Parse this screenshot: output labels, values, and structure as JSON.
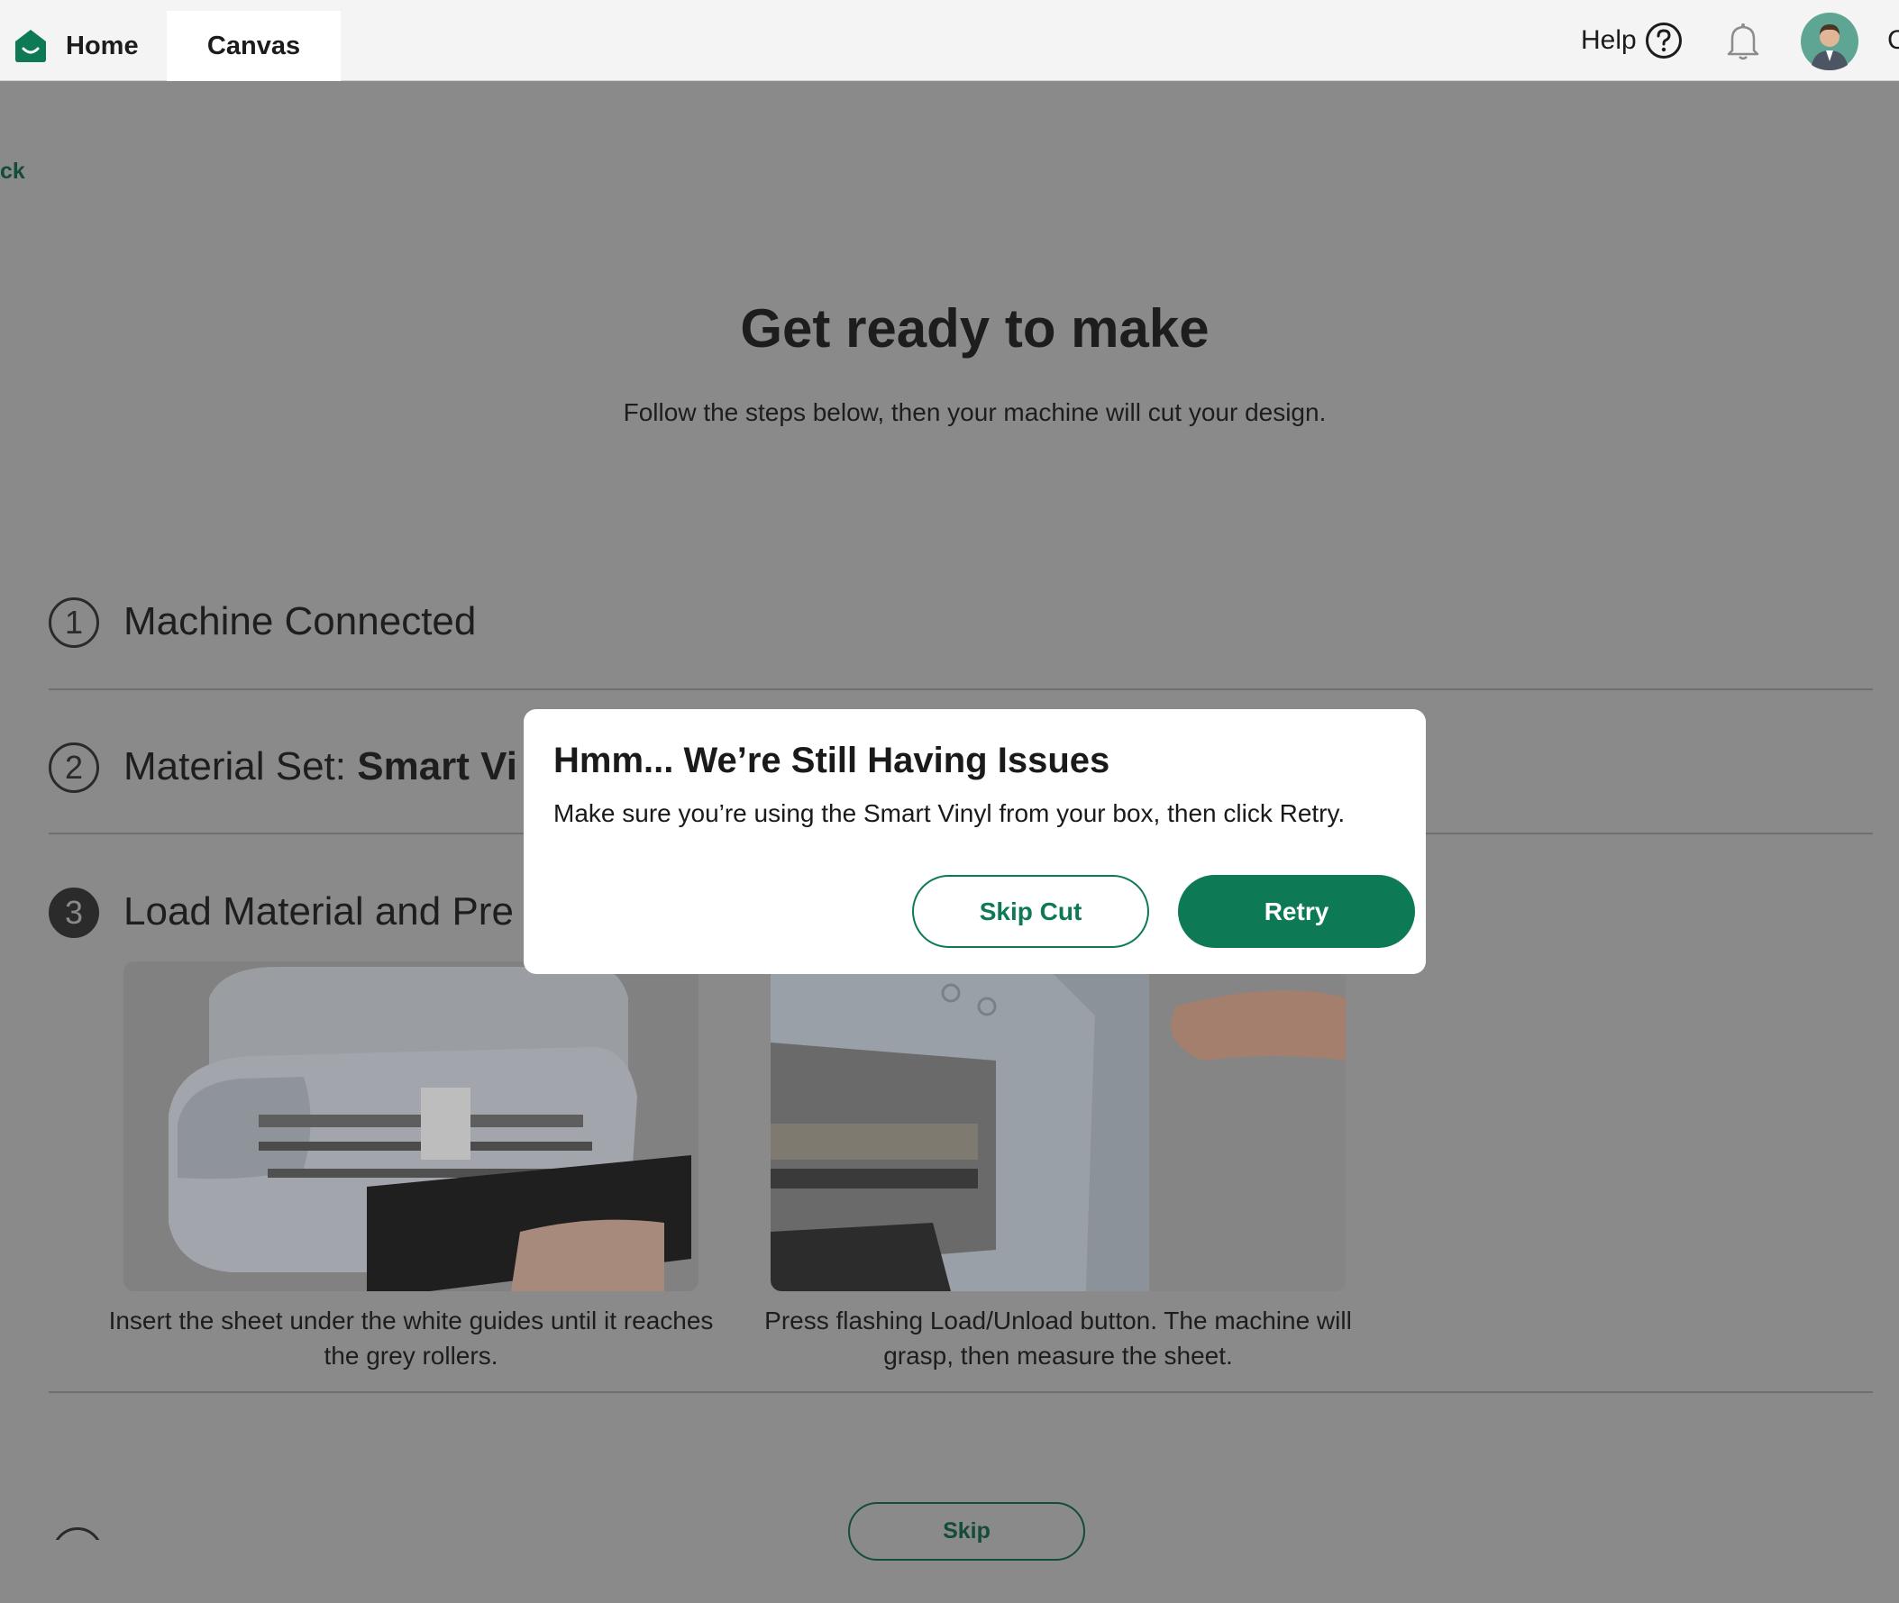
{
  "colors": {
    "brand_green": "#0e7a55",
    "dark_green": "#134c38",
    "overlay_gray": "#8a8a8a",
    "topbar_bg": "#f4f4f4"
  },
  "topbar": {
    "tabs": [
      {
        "label": "Home"
      },
      {
        "label": "Canvas"
      }
    ],
    "help_label": "Help",
    "icons": [
      "home-logo-icon",
      "help-icon",
      "bell-icon",
      "avatar"
    ],
    "cut_off_label": "C"
  },
  "page": {
    "back_label": "ck",
    "title": "Get ready to make",
    "subtitle": "Follow the steps below, then your machine will cut your design.",
    "steps": [
      {
        "number": "1",
        "title": "Machine Connected"
      },
      {
        "number": "2",
        "title_prefix": "Material Set: ",
        "title_bold": "Smart Vi"
      },
      {
        "number": "3",
        "title": "Load Material and Pre"
      }
    ],
    "instructions": [
      {
        "caption": "Insert the sheet under the white guides until it reaches the grey rollers."
      },
      {
        "caption": "Press flashing Load/Unload button. The machine will grasp, then measure the sheet."
      }
    ],
    "skip_label": "Skip"
  },
  "modal": {
    "title": "Hmm... We’re Still Having Issues",
    "body": "Make sure you’re using the Smart Vinyl from your box, then click Retry.",
    "skip_cut_label": "Skip Cut",
    "retry_label": "Retry"
  }
}
